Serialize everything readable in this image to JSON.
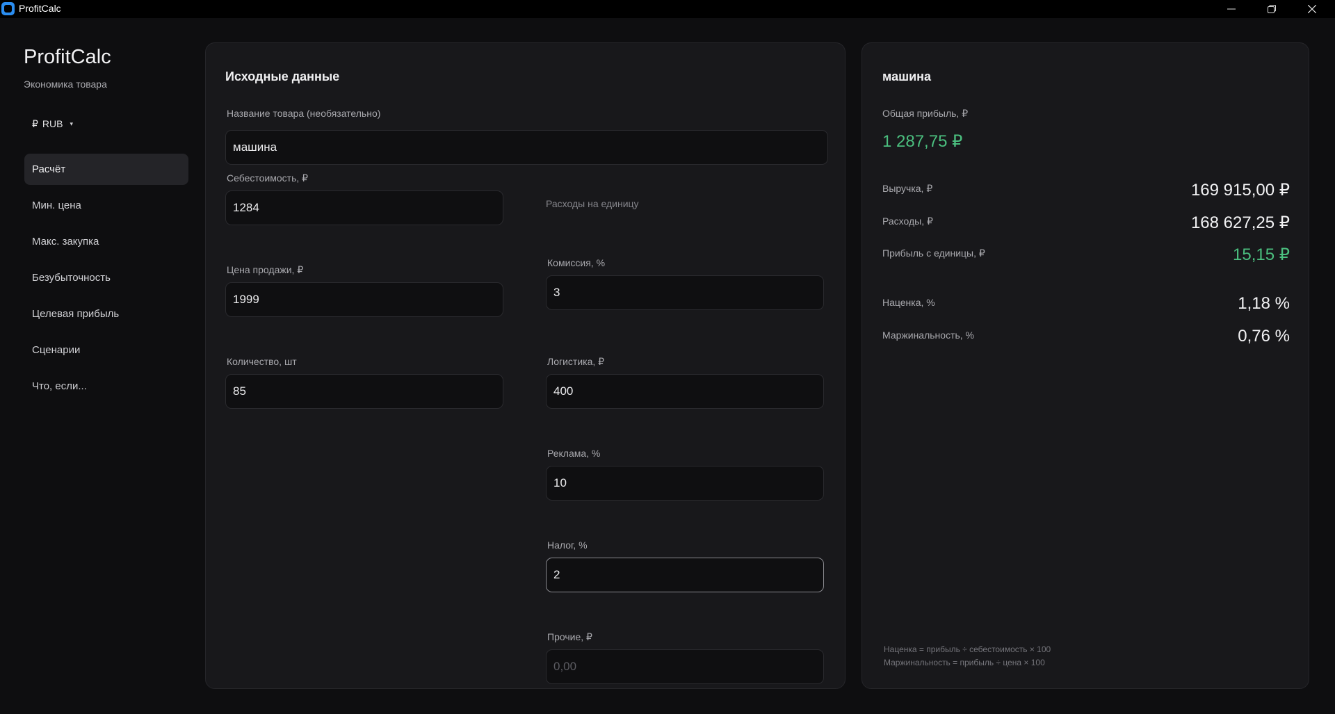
{
  "window": {
    "title": "ProfitCalc",
    "minimize_glyph": "─",
    "maximize_glyph": "❐",
    "close_glyph": "✕"
  },
  "sidebar": {
    "app_title": "ProfitCalc",
    "app_subtitle": "Экономика товара",
    "currency": {
      "symbol": "₽",
      "code": "RUB",
      "caret": "▾"
    },
    "items": [
      {
        "label": "Расчёт",
        "active": true
      },
      {
        "label": "Мин. цена"
      },
      {
        "label": "Макс. закупка"
      },
      {
        "label": "Безубыточность"
      },
      {
        "label": "Целевая прибыль"
      },
      {
        "label": "Сценарии"
      },
      {
        "label": "Что, если..."
      }
    ]
  },
  "input": {
    "title": "Исходные данные",
    "product_name": {
      "label": "Название товара (необязательно)",
      "value": "машина"
    },
    "cost": {
      "label": "Себестоимость, ₽",
      "value": "1284"
    },
    "price": {
      "label": "Цена продажи, ₽",
      "value": "1999"
    },
    "quantity": {
      "label": "Количество, шт",
      "value": "85"
    },
    "unit_expenses_heading": "Расходы на единицу",
    "commission": {
      "label": "Комиссия, %",
      "value": "3"
    },
    "logistics": {
      "label": "Логистика, ₽",
      "value": "400"
    },
    "ads": {
      "label": "Реклама, %",
      "value": "10"
    },
    "tax": {
      "label": "Налог, %",
      "value": "2"
    },
    "other": {
      "label": "Прочие, ₽",
      "value": "",
      "placeholder": "0,00"
    }
  },
  "result": {
    "title": "машина",
    "total_profit_label": "Общая прибыль, ₽",
    "total_profit_value": "1 287,75 ₽",
    "rows": {
      "revenue": {
        "label": "Выручка, ₽",
        "value": "169 915,00 ₽"
      },
      "expenses": {
        "label": "Расходы, ₽",
        "value": "168 627,25 ₽"
      },
      "unit_profit": {
        "label": "Прибыль с единицы, ₽",
        "value": "15,15 ₽"
      },
      "markup": {
        "label": "Наценка, %",
        "value": "1,18 %"
      },
      "margin": {
        "label": "Маржинальность, %",
        "value": "0,76 %"
      }
    },
    "formula_markup": "Наценка = прибыль ÷ себестоимость × 100",
    "formula_margin": "Маржинальность = прибыль ÷ цена × 100"
  },
  "colors": {
    "background": "#0e0e10",
    "card": "#18181b",
    "accent_green": "#4bbf7f",
    "app_icon": "#2a8df0"
  }
}
